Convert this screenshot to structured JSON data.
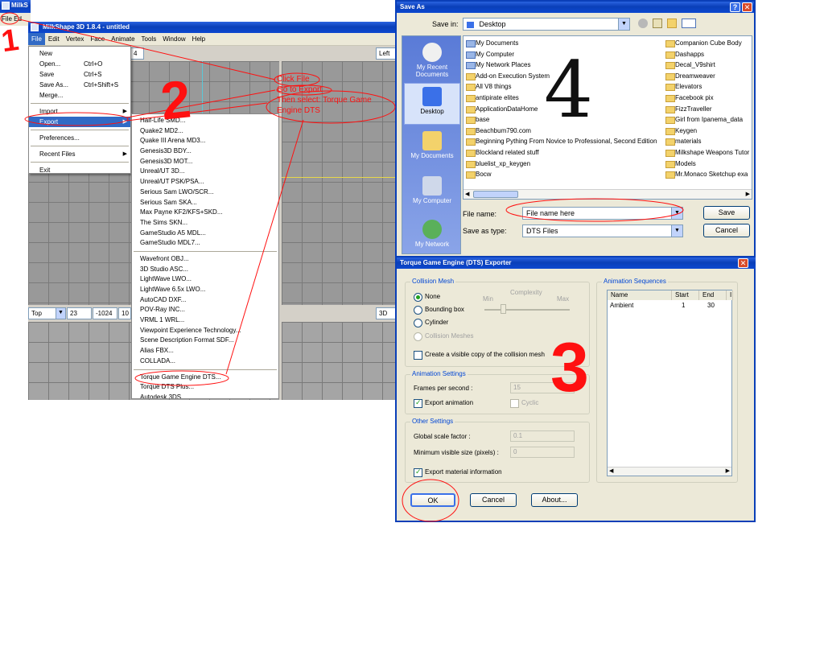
{
  "background_window": {
    "title": "MilkS",
    "menu": "File Ed"
  },
  "milkshape": {
    "title": "MilkShape 3D 1.8.4 - untitled",
    "menus": [
      "File",
      "Edit",
      "Vertex",
      "Face",
      "Animate",
      "Tools",
      "Window",
      "Help"
    ],
    "file_menu": [
      {
        "label": "New",
        "shortcut": ""
      },
      {
        "label": "Open...",
        "shortcut": "Ctrl+O"
      },
      {
        "label": "Save",
        "shortcut": "Ctrl+S"
      },
      {
        "label": "Save As...",
        "shortcut": "Ctrl+Shift+S"
      },
      {
        "label": "Merge...",
        "shortcut": ""
      },
      {
        "label": "Import",
        "shortcut": ""
      },
      {
        "label": "Export",
        "shortcut": ""
      },
      {
        "label": "Preferences...",
        "shortcut": ""
      },
      {
        "label": "Recent Files",
        "shortcut": ""
      },
      {
        "label": "Exit",
        "shortcut": ""
      }
    ],
    "export_menu_group1": [
      "Half-Life SMD...",
      "Quake2 MD2...",
      "Quake III Arena MD3...",
      "Genesis3D BDY...",
      "Genesis3D MOT...",
      "Unreal/UT 3D...",
      "Unreal/UT PSK/PSA...",
      "Serious Sam LWO/SCR...",
      "Serious Sam SKA...",
      "Max Payne KF2/KFS+SKD...",
      "The Sims SKN...",
      "GameStudio A5 MDL...",
      "GameStudio MDL7..."
    ],
    "export_menu_group2": [
      "Wavefront OBJ...",
      "3D Studio ASC...",
      "LightWave LWO...",
      "LightWave 6.5x LWO...",
      "AutoCAD DXF...",
      "POV-Ray INC...",
      "VRML 1 WRL...",
      "Viewpoint Experience Technology...",
      "Scene Description Format SDF...",
      "Alias FBX...",
      "COLLADA..."
    ],
    "export_menu_group3": [
      "Torque Game Engine DTS...",
      "Torque DTS Plus...",
      "Autodesk 3DS..."
    ],
    "viewport_labels": {
      "top_right": "Left",
      "top_left_field": "4",
      "bottom_left": "Top",
      "bottom_right": "3D"
    },
    "coord_fields": [
      "23",
      "-1024",
      "10"
    ]
  },
  "annotations": {
    "step1": "1",
    "step2": "2",
    "step3": "3",
    "step4": "4",
    "note_click_file": "Click File",
    "note_go_to_export": "Go to Export",
    "note_then_select": "Then select: Torque Game",
    "note_engine_dts": "Engine DTS"
  },
  "save_as": {
    "title": "Save As",
    "save_in_label": "Save in:",
    "save_in_value": "Desktop",
    "places": [
      "My Recent Documents",
      "Desktop",
      "My Documents",
      "My Computer",
      "My Network"
    ],
    "files_col1": [
      "My Documents",
      "My Computer",
      "My Network Places",
      "Add-on Execution System",
      "All V8 things",
      "antipirate elites",
      "ApplicationDataHome",
      "base",
      "Beachbum790.com",
      "Beginning Pything From Novice to Professional, Second Edition",
      "Blockland related stuff",
      "bluelist_xp_keygen",
      "Bocw"
    ],
    "files_col2": [
      "Companion Cube Body",
      "Dashapps",
      "Decal_V9shirt",
      "Dreamweaver",
      "Elevators",
      "Facebook pix",
      "FizzTraveller",
      "Girl from Ipanema_data",
      "Keygen",
      "materials",
      "Milkshape Weapons Tutor",
      "Models",
      "Mr.Monaco Sketchup exa"
    ],
    "file_name_label": "File name:",
    "file_name_value": "File name here",
    "save_type_label": "Save as type:",
    "save_type_value": "DTS Files",
    "save_button": "Save",
    "cancel_button": "Cancel"
  },
  "exporter": {
    "title": "Torque Game Engine (DTS) Exporter",
    "collision_group": "Collision Mesh",
    "complexity_label": "Complexity",
    "min_label": "Min",
    "max_label": "Max",
    "radio_none": "None",
    "radio_bounding": "Bounding box",
    "radio_cylinder": "Cylinder",
    "radio_collision": "Collision Meshes",
    "visible_copy": "Create a visible copy of the collision mesh",
    "anim_settings_group": "Animation Settings",
    "fps_label": "Frames per second :",
    "fps_value": "15",
    "export_animation": "Export animation",
    "cyclic": "Cyclic",
    "other_group": "Other Settings",
    "scale_label": "Global scale factor :",
    "scale_value": "0.1",
    "min_size_label": "Minimum visible size (pixels) :",
    "min_size_value": "0",
    "export_material": "Export material information",
    "anim_seq_group": "Animation Sequences",
    "col_name": "Name",
    "col_start": "Start",
    "col_end": "End",
    "col_extra": "I",
    "seq_name": "Ambient",
    "seq_start": "1",
    "seq_end": "30",
    "ok_button": "OK",
    "cancel_button": "Cancel",
    "about_button": "About..."
  }
}
